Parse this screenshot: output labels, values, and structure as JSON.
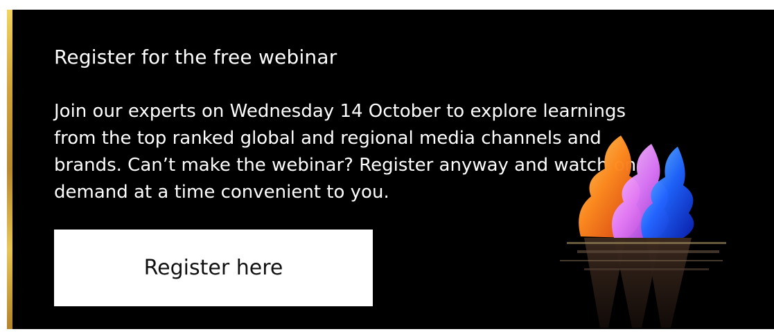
{
  "banner": {
    "title": "Register for the free webinar",
    "description": "Join our experts on Wednesday 14 October to explore learnings\nfrom the top ranked global and regional media channels and\nbrands.  Can’t make the webinar?  Register anyway and watch on\ndemand at a time convenient to you.",
    "cta_label": "Register here",
    "illustration_icon": "ice-cream-cones-icon",
    "colors": {
      "background": "#000000",
      "accent_gold": "#d4a93c",
      "button_background": "#ffffff",
      "cone_orange": "#ff8a1f",
      "cone_pink": "#e27bff",
      "cone_blue": "#1f64ff"
    }
  }
}
